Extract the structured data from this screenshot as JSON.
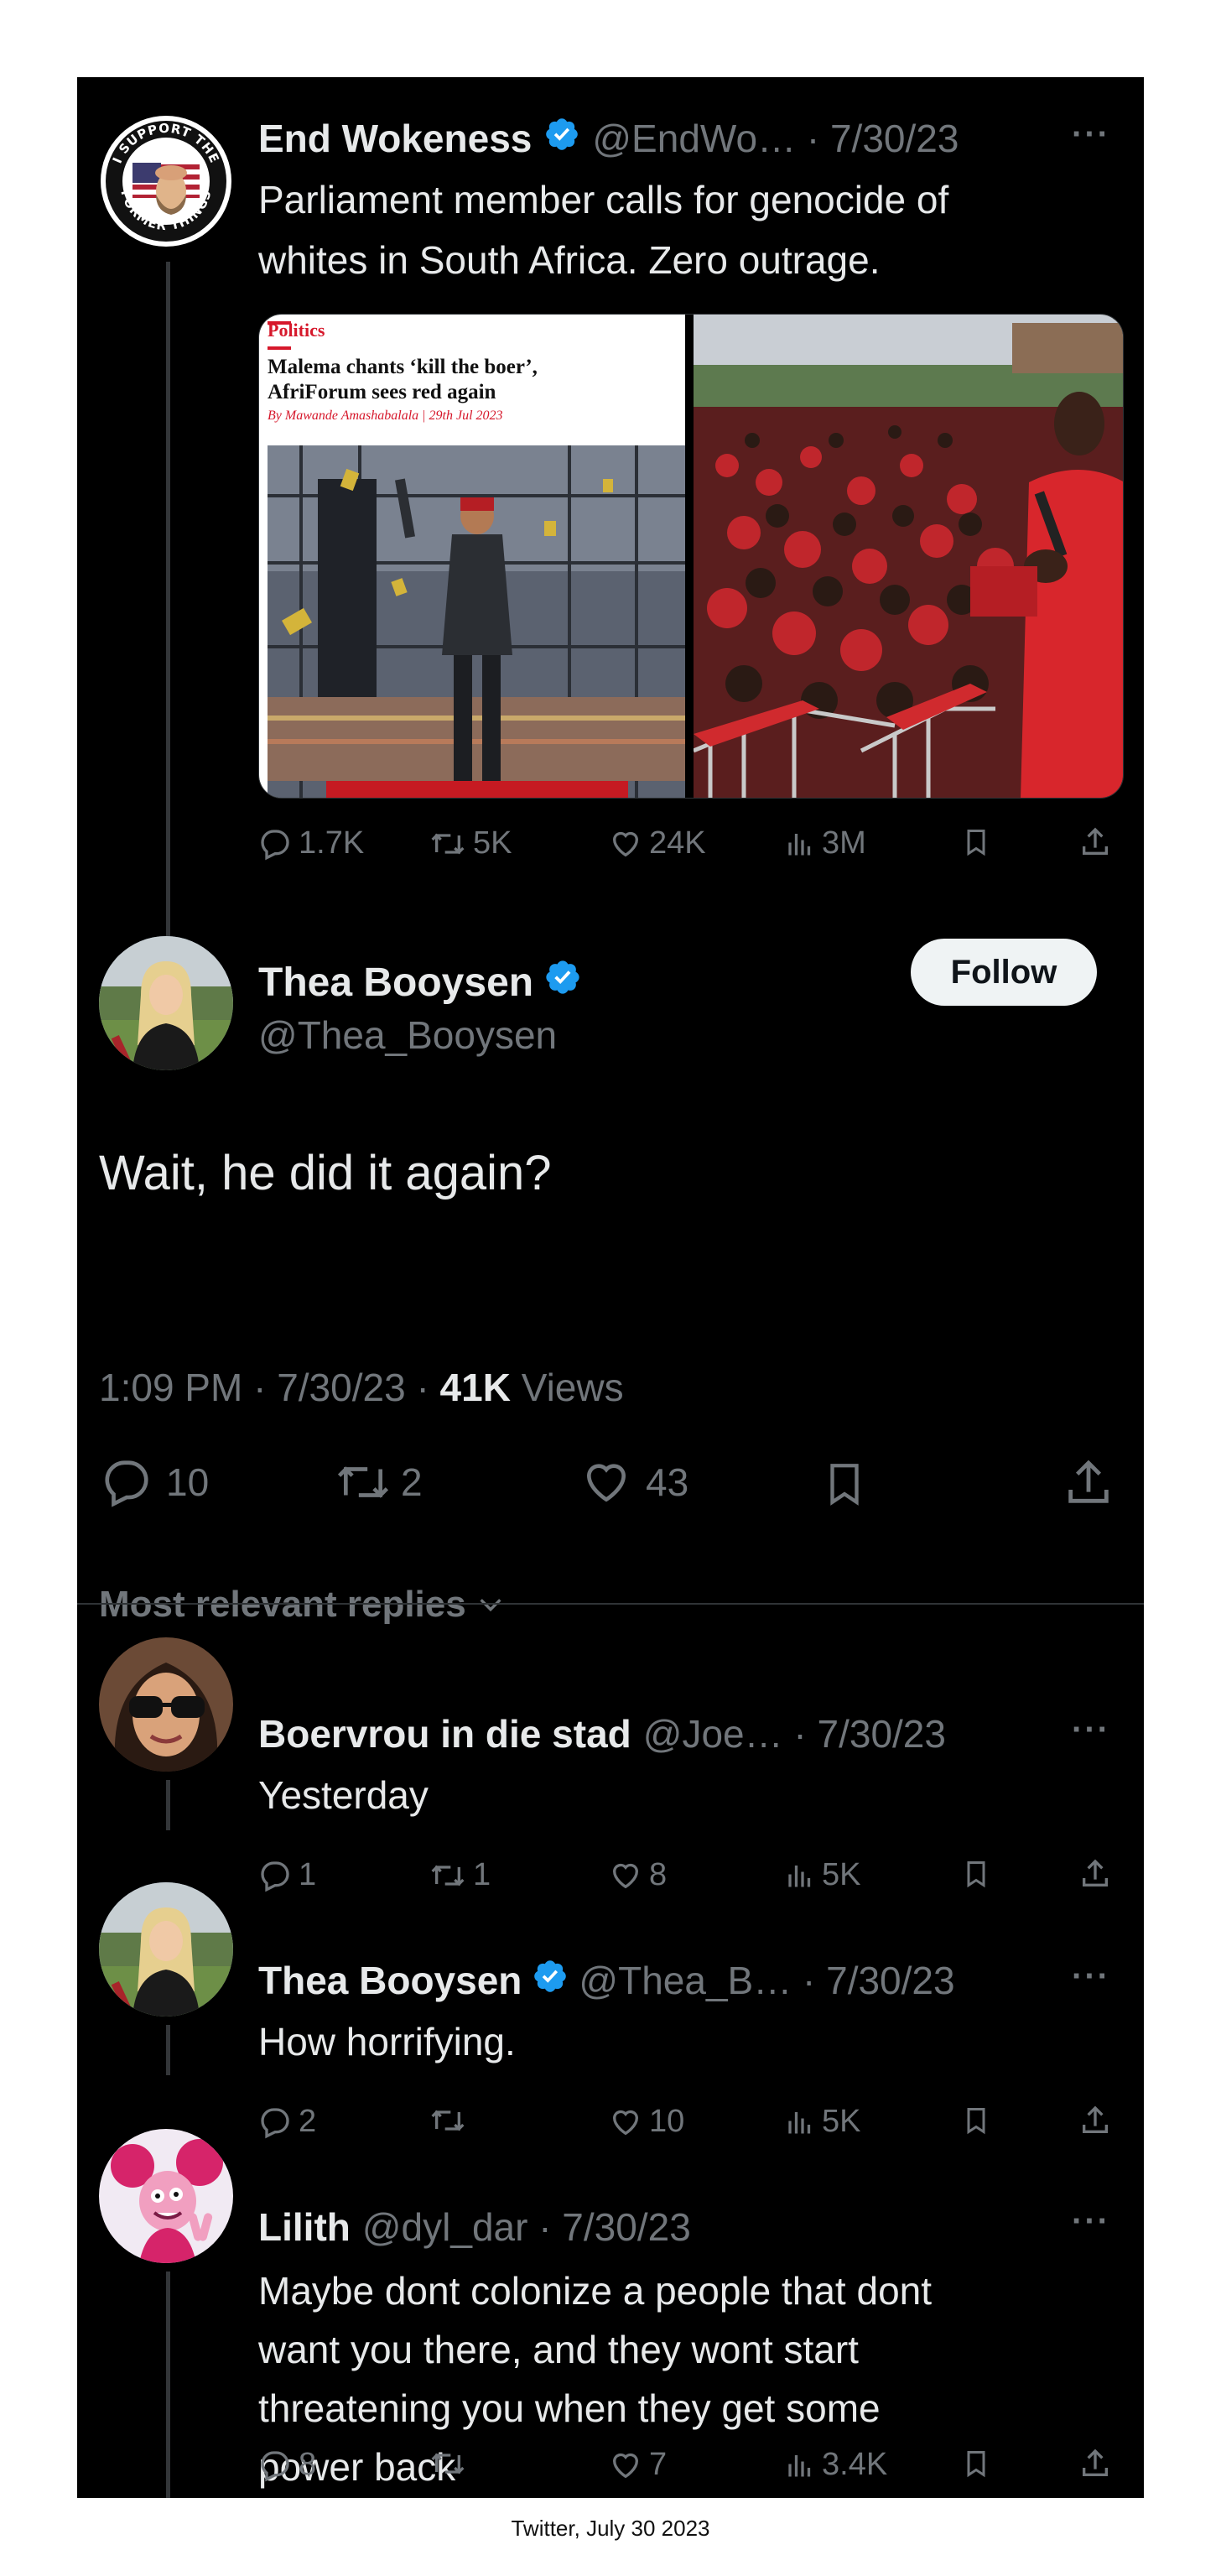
{
  "main_tweet": {
    "author_name": "End Wokeness",
    "handle_date": "@EndWo… · 7/30/23",
    "text_line1": "Parliament member calls for genocide of",
    "text_line2": "whites in South Africa. Zero outrage.",
    "avatar_text_top": "I SUPPORT THE",
    "avatar_text_bottom": "FORMER THINGS",
    "media_left": {
      "section": "Politics",
      "headline_line1": "Malema chants ‘kill the boer’,",
      "headline_line2": "AfriForum sees red again",
      "byline": "By Mawande Amashabalala | 29th Jul 2023"
    },
    "stats": {
      "replies": "1.7K",
      "retweets": "5K",
      "likes": "24K",
      "views": "3M"
    }
  },
  "focus_tweet": {
    "author_name": "Thea Booysen",
    "handle": "@Thea_Booysen",
    "follow_label": "Follow",
    "text": "Wait, he did it again?",
    "meta_prefix": "1:09 PM · 7/30/23 · ",
    "views_count": "41K",
    "views_label": " Views",
    "stats": {
      "replies": "10",
      "retweets": "2",
      "likes": "43"
    }
  },
  "replies_sort_label": "Most relevant replies",
  "replies": [
    {
      "author_name": "Boervrou in die stad",
      "handle_date": "@Joe… · 7/30/23",
      "text": "Yesterday",
      "stats": {
        "replies": "1",
        "retweets": "1",
        "likes": "8",
        "views": "5K"
      }
    },
    {
      "author_name": "Thea Booysen",
      "handle_date": "@Thea_B… · 7/30/23",
      "text": "How horrifying.",
      "stats": {
        "replies": "2",
        "retweets": "",
        "likes": "10",
        "views": "5K"
      }
    },
    {
      "author_name": "Lilith",
      "handle_date": "@dyl_dar · 7/30/23",
      "text_line1": "Maybe dont colonize a people that dont",
      "text_line2": "want you there, and they wont start",
      "text_line3": "threatening you when they get some",
      "text_line4": "power back",
      "stats": {
        "replies": "8",
        "retweets": "",
        "likes": "7",
        "views": "3.4K"
      }
    }
  ],
  "caption": "Twitter, July 30 2023",
  "colors": {
    "background": "#000000",
    "text": "#e7e9ea",
    "muted": "#71767b",
    "verified": "#1d9bf0",
    "divider": "#2f3336"
  },
  "icons": [
    "reply-icon",
    "retweet-icon",
    "like-icon",
    "views-icon",
    "bookmark-icon",
    "share-icon",
    "verified-badge-icon",
    "more-icon",
    "chevron-down-icon"
  ]
}
